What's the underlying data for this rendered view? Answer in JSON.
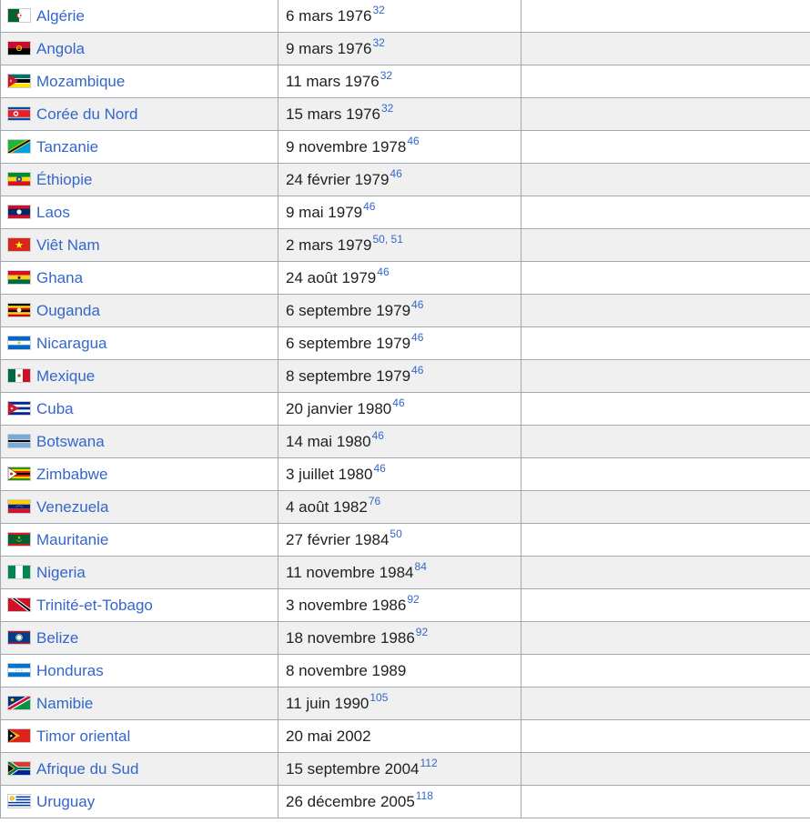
{
  "rows": [
    {
      "country": "Algérie",
      "flag": "algeria-flag-icon",
      "date": "6 mars 1976",
      "ref": "32"
    },
    {
      "country": "Angola",
      "flag": "angola-flag-icon",
      "date": "9 mars 1976",
      "ref": "32"
    },
    {
      "country": "Mozambique",
      "flag": "mozambique-flag-icon",
      "date": "11 mars 1976",
      "ref": "32"
    },
    {
      "country": "Corée du Nord",
      "flag": "north-korea-flag-icon",
      "date": "15 mars 1976",
      "ref": "32"
    },
    {
      "country": "Tanzanie",
      "flag": "tanzania-flag-icon",
      "date": "9 novembre 1978",
      "ref": "46"
    },
    {
      "country": "Éthiopie",
      "flag": "ethiopia-flag-icon",
      "date": "24 février 1979",
      "ref": "46"
    },
    {
      "country": "Laos",
      "flag": "laos-flag-icon",
      "date": "9 mai 1979",
      "ref": "46"
    },
    {
      "country": "Viêt Nam",
      "flag": "vietnam-flag-icon",
      "date": "2 mars 1979",
      "ref": "50, 51"
    },
    {
      "country": "Ghana",
      "flag": "ghana-flag-icon",
      "date": "24 août 1979",
      "ref": "46"
    },
    {
      "country": "Ouganda",
      "flag": "uganda-flag-icon",
      "date": "6 septembre 1979",
      "ref": "46"
    },
    {
      "country": "Nicaragua",
      "flag": "nicaragua-flag-icon",
      "date": "6 septembre 1979",
      "ref": "46"
    },
    {
      "country": "Mexique",
      "flag": "mexico-flag-icon",
      "date": "8 septembre 1979",
      "ref": "46"
    },
    {
      "country": "Cuba",
      "flag": "cuba-flag-icon",
      "date": "20 janvier 1980",
      "ref": "46"
    },
    {
      "country": "Botswana",
      "flag": "botswana-flag-icon",
      "date": "14 mai 1980",
      "ref": "46"
    },
    {
      "country": "Zimbabwe",
      "flag": "zimbabwe-flag-icon",
      "date": "3 juillet 1980",
      "ref": "46"
    },
    {
      "country": "Venezuela",
      "flag": "venezuela-flag-icon",
      "date": "4 août 1982",
      "ref": "76"
    },
    {
      "country": "Mauritanie",
      "flag": "mauritania-flag-icon",
      "date": "27 février 1984",
      "ref": "50"
    },
    {
      "country": "Nigeria",
      "flag": "nigeria-flag-icon",
      "date": "11 novembre 1984",
      "ref": "84"
    },
    {
      "country": "Trinité-et-Tobago",
      "flag": "trinidad-tobago-flag-icon",
      "date": "3 novembre 1986",
      "ref": "92"
    },
    {
      "country": "Belize",
      "flag": "belize-flag-icon",
      "date": "18 novembre 1986",
      "ref": "92"
    },
    {
      "country": "Honduras",
      "flag": "honduras-flag-icon",
      "date": "8 novembre 1989",
      "ref": ""
    },
    {
      "country": "Namibie",
      "flag": "namibia-flag-icon",
      "date": "11 juin 1990",
      "ref": "105"
    },
    {
      "country": "Timor oriental",
      "flag": "east-timor-flag-icon",
      "date": "20 mai 2002",
      "ref": ""
    },
    {
      "country": "Afrique du Sud",
      "flag": "south-africa-flag-icon",
      "date": "15 septembre 2004",
      "ref": "112"
    },
    {
      "country": "Uruguay",
      "flag": "uruguay-flag-icon",
      "date": "26 décembre 2005",
      "ref": "118"
    }
  ],
  "colors": {
    "link": "#3366cc",
    "text": "#202122",
    "border": "#a2a9b1",
    "row_stripe": "#f0f0f0"
  }
}
